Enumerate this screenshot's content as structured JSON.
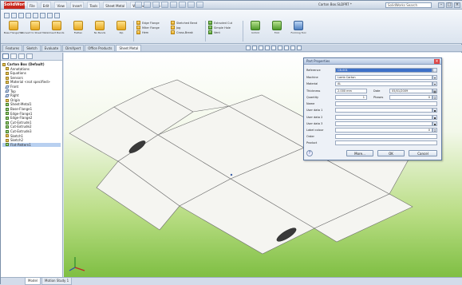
{
  "app": {
    "logo": "SolidWorks",
    "document_title": "Carton Box.SLDPRT *",
    "search_placeholder": "SolidWorks Search"
  },
  "menu": [
    "File",
    "Edit",
    "View",
    "Insert",
    "Tools",
    "Sheet Metal",
    "Window",
    "Help"
  ],
  "ribbon": {
    "large_buttons": [
      {
        "label": "Base Flange/Tab",
        "icon": "base-flange-icon",
        "color": "yellow"
      },
      {
        "label": "Convert to Sheet Metal",
        "icon": "convert-icon",
        "color": "yellow"
      },
      {
        "label": "Insert Bends",
        "icon": "insert-bends-icon",
        "color": "yellow"
      },
      {
        "label": "Flatten",
        "icon": "flatten-icon",
        "color": "yellow"
      },
      {
        "label": "No Bends",
        "icon": "no-bends-icon",
        "color": "yellow"
      },
      {
        "label": "Rip",
        "icon": "rip-icon",
        "color": "yellow"
      }
    ],
    "small_group_1": [
      "Edge Flange",
      "Miter Flange",
      "Hem"
    ],
    "small_group_2": [
      "Sketched Bend",
      "Jog",
      "Cross-Break"
    ],
    "small_group_3": [
      "Extruded Cut",
      "Simple Hole",
      "Vent"
    ],
    "right_buttons": [
      {
        "label": "Unfold",
        "icon": "unfold-icon",
        "color": "green"
      },
      {
        "label": "Fold",
        "icon": "fold-icon",
        "color": "green"
      },
      {
        "label": "Forming Tool",
        "icon": "forming-tool-icon",
        "color": "blue"
      }
    ]
  },
  "command_tabs": [
    "Features",
    "Sketch",
    "Evaluate",
    "DimXpert",
    "Office Products",
    "Sheet Metal"
  ],
  "active_command_tab": "Sheet Metal",
  "feature_tree": [
    {
      "label": "Carton Box (Default)",
      "type": "top"
    },
    {
      "label": "Annotations",
      "type": "folder",
      "indent": 1
    },
    {
      "label": "Equations",
      "type": "folder",
      "indent": 1
    },
    {
      "label": "Sensors",
      "type": "folder",
      "indent": 1
    },
    {
      "label": "Material <not specified>",
      "type": "folder",
      "indent": 1
    },
    {
      "label": "Front",
      "type": "plane",
      "indent": 1
    },
    {
      "label": "Top",
      "type": "plane",
      "indent": 1
    },
    {
      "label": "Right",
      "type": "plane",
      "indent": 1
    },
    {
      "label": "Origin",
      "type": "folder",
      "indent": 1
    },
    {
      "label": "Sheet-Metal1",
      "type": "feat",
      "indent": 1
    },
    {
      "label": "Base-Flange1",
      "type": "feat",
      "indent": 1
    },
    {
      "label": "Edge-Flange1",
      "type": "feat",
      "indent": 1
    },
    {
      "label": "Edge-Flange2",
      "type": "feat",
      "indent": 1
    },
    {
      "label": "Cut-Extrude1",
      "type": "feat",
      "indent": 1
    },
    {
      "label": "Cut-Extrude2",
      "type": "feat",
      "indent": 1
    },
    {
      "label": "Cut-Extrude3",
      "type": "feat",
      "indent": 1
    },
    {
      "label": "Sketch1",
      "type": "folder",
      "indent": 1
    },
    {
      "label": "Sketch2",
      "type": "folder",
      "indent": 1
    },
    {
      "label": "Flat-Pattern1",
      "type": "feat",
      "indent": 1,
      "selected": true
    }
  ],
  "bottom_tabs": [
    "Model",
    "Motion Study 1"
  ],
  "active_bottom_tab": "Model",
  "dialog": {
    "title": "Part Properties",
    "fields": {
      "reference": {
        "label": "Reference",
        "value": "CB-001"
      },
      "machine": {
        "label": "Machine",
        "value": "Lamb Carton"
      },
      "material": {
        "label": "Material",
        "value": "AL"
      },
      "thickness": {
        "label": "Thickness",
        "value": "2.000 mm"
      },
      "date_label": "Date",
      "date": "05/01/2009",
      "quantity": {
        "label": "Quantity",
        "value": "1"
      },
      "phases_label": "Phases",
      "phases": "0",
      "name": {
        "label": "Name",
        "value": ""
      },
      "user_data_1": {
        "label": "User data 1",
        "value": ""
      },
      "user_data_2": {
        "label": "User data 2",
        "value": ""
      },
      "user_data_3": {
        "label": "User data 3",
        "value": ""
      },
      "label_color": {
        "label": "Label colour",
        "value": "0"
      },
      "order": {
        "label": "Order",
        "value": ""
      },
      "product": {
        "label": "Product",
        "value": ""
      }
    },
    "buttons": {
      "more": "More...",
      "ok": "OK",
      "cancel": "Cancel"
    }
  },
  "colors": {
    "background_top": "#ffffff",
    "background_bottom": "#7fbf43",
    "part_face": "#f5f5f1",
    "dialog_frame": "#5e7aa2"
  }
}
